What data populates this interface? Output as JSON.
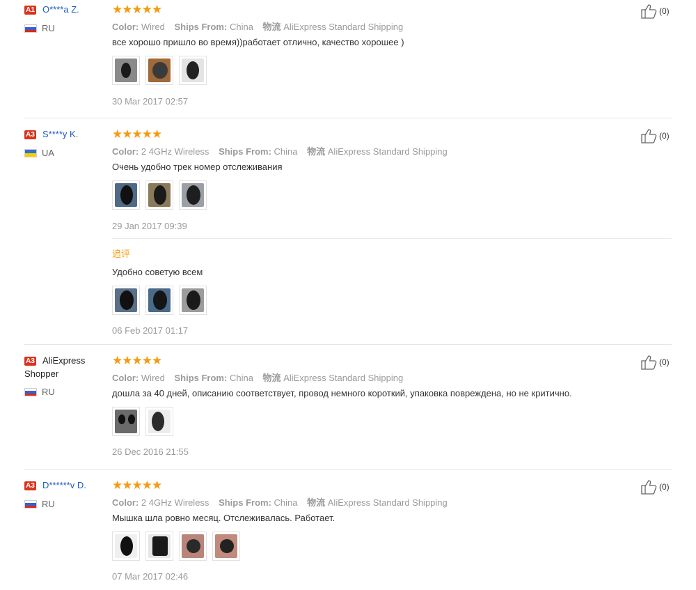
{
  "reviews": [
    {
      "badge": "A1",
      "name": "O****a Z.",
      "country": "RU",
      "flag": "ru",
      "stars": "★★★★★",
      "color_label": "Color:",
      "color_value": "Wired",
      "ships_label": "Ships From:",
      "ships_value": "China",
      "logistics_label": "物流",
      "logistics_value": "AliExpress Standard Shipping",
      "text": "все хорошо пришло во время))работает отлично, качество хорошее )",
      "date": "30 Mar 2017 02:57",
      "likes": "(0)"
    },
    {
      "badge": "A3",
      "name": "S****y K.",
      "country": "UA",
      "flag": "ua",
      "stars": "★★★★★",
      "color_label": "Color:",
      "color_value": "2 4GHz Wireless",
      "ships_label": "Ships From:",
      "ships_value": "China",
      "logistics_label": "物流",
      "logistics_value": "AliExpress Standard Shipping",
      "text": "Очень удобно трек номер отслеживания",
      "date": "29 Jan 2017 09:39",
      "followup_label": "追评",
      "followup_text": "Удобно советую всем",
      "followup_date": "06 Feb 2017 01:17",
      "likes": "(0)"
    },
    {
      "badge": "A3",
      "name_line1": "AliExpress",
      "name_line2": "Shopper",
      "country": "RU",
      "flag": "ru",
      "stars": "★★★★★",
      "color_label": "Color:",
      "color_value": "Wired",
      "ships_label": "Ships From:",
      "ships_value": "China",
      "logistics_label": "物流",
      "logistics_value": "AliExpress Standard Shipping",
      "text": "дошла за 40 дней, описанию соответствует, провод немного короткий, упаковка повреждена, но не критично.",
      "date": "26 Dec 2016 21:55",
      "likes": "(0)"
    },
    {
      "badge": "A3",
      "name": "D******v D.",
      "country": "RU",
      "flag": "ru",
      "stars": "★★★★★",
      "color_label": "Color:",
      "color_value": "2 4GHz Wireless",
      "ships_label": "Ships From:",
      "ships_value": "China",
      "logistics_label": "物流",
      "logistics_value": "AliExpress Standard Shipping",
      "text": "Мышка шла ровно месяц. Отслеживалась. Работает.",
      "date": "07 Mar 2017 02:46",
      "likes": "(0)"
    }
  ],
  "colors": {
    "star": "#f39c12",
    "badge": "#d9341f",
    "username": "#1f5bbd",
    "meta": "#9a9a9a",
    "followup": "#f39c12"
  },
  "icons": {
    "like": "thumbs-up-icon",
    "rating": "star-icon"
  }
}
